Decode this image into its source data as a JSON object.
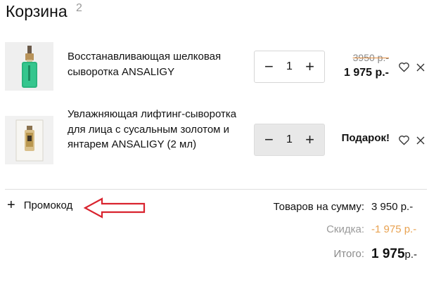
{
  "cart": {
    "title": "Корзина",
    "count": "2"
  },
  "items": [
    {
      "name": "Восстанавливающая шелковая сыворотка ANSALIGY",
      "quantity": "1",
      "old_price": "3950 р.-",
      "price": "1 975 р.-",
      "image_icon": "serum-bottle-image"
    },
    {
      "name": "Увлажняющая лифтинг-сыворотка для лица с сусальным золотом и янтарем ANSALIGY (2 мл)",
      "quantity": "1",
      "gift_label": "Подарок!",
      "image_icon": "serum-sachet-image"
    }
  ],
  "controls": {
    "minus": "−",
    "plus": "+",
    "close": "×"
  },
  "promo": {
    "plus": "+",
    "label": "Промокод"
  },
  "summary": {
    "goods_label": "Товаров на сумму:",
    "goods_value": "3 950 р.-",
    "discount_label": "Скидка:",
    "discount_value": "-1 975 р.-",
    "total_label": "Итого:",
    "total_amount": "1 975",
    "total_currency": "р.-"
  },
  "colors": {
    "annotation_arrow": "#d9232e",
    "discount": "#e8a251",
    "accent_green": "#2bb57f"
  }
}
